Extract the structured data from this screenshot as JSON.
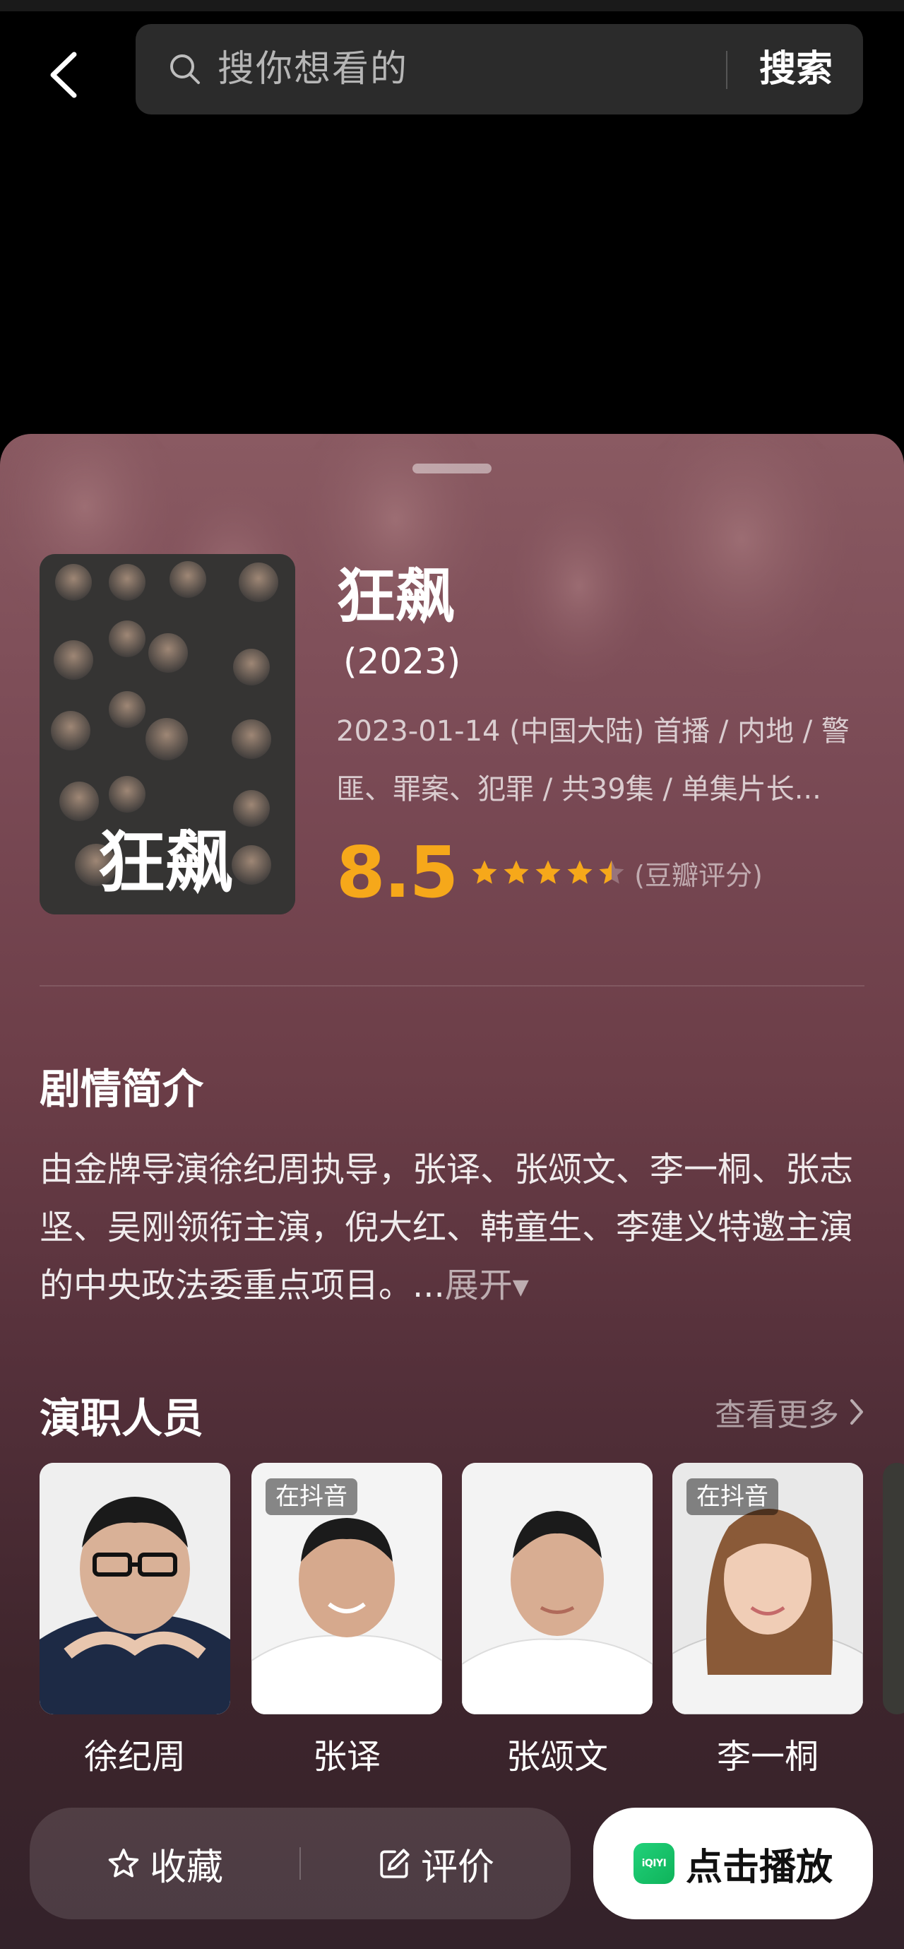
{
  "search": {
    "placeholder": "搜你想看的",
    "button_label": "搜索"
  },
  "show": {
    "title": "狂飙",
    "year": "(2023)",
    "meta_line1": "2023-01-14 (中国大陆) 首播 / 内地 / 警",
    "meta_line2": "匪、罪案、犯罪 / 共39集 / 单集片长...",
    "score": "8.5",
    "score_out_of_5_stars": 4.25,
    "rating_source": "(豆瓣评分)",
    "poster_title": "狂飙"
  },
  "synopsis": {
    "heading": "剧情简介",
    "text": "由金牌导演徐纪周执导，张译、张颂文、李一桐、张志坚、吴刚领衔主演，倪大红、韩童生、李建义特邀主演的中央政法委重点项目。...",
    "expand_label": "展开",
    "expand_arrow": "▼"
  },
  "cast": {
    "heading": "演职人员",
    "see_more_label": "查看更多",
    "members": [
      {
        "name": "徐纪周",
        "badge": ""
      },
      {
        "name": "张译",
        "badge": "在抖音"
      },
      {
        "name": "张颂文",
        "badge": ""
      },
      {
        "name": "李一桐",
        "badge": "在抖音"
      }
    ]
  },
  "actions": {
    "favorite_label": "收藏",
    "review_label": "评价",
    "play_label": "点击播放",
    "play_logo_text": "iQIYI"
  },
  "colors": {
    "accent_score": "#f6a81a",
    "star": "#f6a81a",
    "iqiyi_green": "#21d17a"
  }
}
